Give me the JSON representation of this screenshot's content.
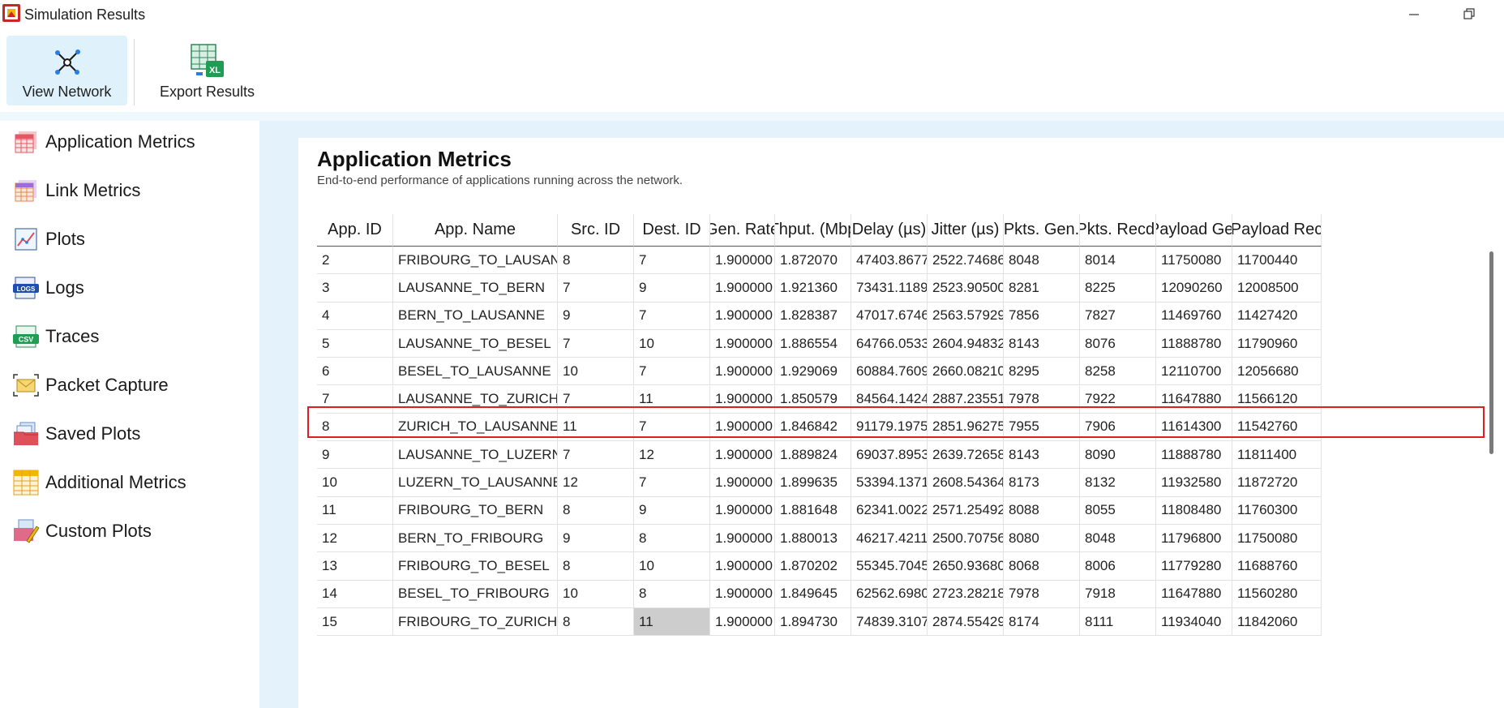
{
  "window": {
    "title": "Simulation Results"
  },
  "ribbon": {
    "view_network": "View Network",
    "export_results": "Export Results",
    "export_badge": "XL"
  },
  "sidebar": {
    "items": [
      {
        "label": "Application Metrics",
        "icon": "table-icon"
      },
      {
        "label": "Link Metrics",
        "icon": "table-icon"
      },
      {
        "label": "Plots",
        "icon": "plot-icon"
      },
      {
        "label": "Logs",
        "icon": "logs-icon"
      },
      {
        "label": "Traces",
        "icon": "csv-icon"
      },
      {
        "label": "Packet Capture",
        "icon": "envelope-icon"
      },
      {
        "label": "Saved Plots",
        "icon": "saved-plots-icon"
      },
      {
        "label": "Additional Metrics",
        "icon": "table-icon"
      },
      {
        "label": "Custom Plots",
        "icon": "custom-plot-icon"
      }
    ],
    "badges": {
      "logs": "LOGS",
      "csv": "CSV"
    }
  },
  "panel": {
    "title": "Application Metrics",
    "subtitle": "End-to-end performance of applications running across the network."
  },
  "table": {
    "headers": [
      "App. ID",
      "App. Name",
      "Src. ID",
      "Dest. ID",
      "Gen. Rate",
      "Thput. (Mbp",
      "Delay (µs)",
      "Jitter (µs)",
      "Pkts. Gen.",
      "Pkts. Recd.",
      "Payload Ger",
      "Payload Rec"
    ],
    "rows": [
      [
        "2",
        "FRIBOURG_TO_LAUSANNE",
        "8",
        "7",
        "1.900000",
        "1.872070",
        "47403.867702",
        "2522.746863",
        "8048",
        "8014",
        "11750080",
        "11700440"
      ],
      [
        "3",
        "LAUSANNE_TO_BERN",
        "7",
        "9",
        "1.900000",
        "1.921360",
        "73431.118981",
        "2523.905009",
        "8281",
        "8225",
        "12090260",
        "12008500"
      ],
      [
        "4",
        "BERN_TO_LAUSANNE",
        "9",
        "7",
        "1.900000",
        "1.828387",
        "47017.674686",
        "2563.579293",
        "7856",
        "7827",
        "11469760",
        "11427420"
      ],
      [
        "5",
        "LAUSANNE_TO_BESEL",
        "7",
        "10",
        "1.900000",
        "1.886554",
        "64766.053382",
        "2604.948328",
        "8143",
        "8076",
        "11888780",
        "11790960"
      ],
      [
        "6",
        "BESEL_TO_LAUSANNE",
        "10",
        "7",
        "1.900000",
        "1.929069",
        "60884.760979",
        "2660.082100",
        "8295",
        "8258",
        "12110700",
        "12056680"
      ],
      [
        "7",
        "LAUSANNE_TO_ZURICH",
        "7",
        "11",
        "1.900000",
        "1.850579",
        "84564.142414",
        "2887.235511",
        "7978",
        "7922",
        "11647880",
        "11566120"
      ],
      [
        "8",
        "ZURICH_TO_LAUSANNE",
        "11",
        "7",
        "1.900000",
        "1.846842",
        "91179.197543",
        "2851.962758",
        "7955",
        "7906",
        "11614300",
        "11542760"
      ],
      [
        "9",
        "LAUSANNE_TO_LUZERN",
        "7",
        "12",
        "1.900000",
        "1.889824",
        "69037.895396",
        "2639.726582",
        "8143",
        "8090",
        "11888780",
        "11811400"
      ],
      [
        "10",
        "LUZERN_TO_LAUSANNE",
        "12",
        "7",
        "1.900000",
        "1.899635",
        "53394.137147",
        "2608.543649",
        "8173",
        "8132",
        "11932580",
        "11872720"
      ],
      [
        "11",
        "FRIBOURG_TO_BERN",
        "8",
        "9",
        "1.900000",
        "1.881648",
        "62341.002288",
        "2571.254927",
        "8088",
        "8055",
        "11808480",
        "11760300"
      ],
      [
        "12",
        "BERN_TO_FRIBOURG",
        "9",
        "8",
        "1.900000",
        "1.880013",
        "46217.421115",
        "2500.707566",
        "8080",
        "8048",
        "11796800",
        "11750080"
      ],
      [
        "13",
        "FRIBOURG_TO_BESEL",
        "8",
        "10",
        "1.900000",
        "1.870202",
        "55345.704541",
        "2650.936804",
        "8068",
        "8006",
        "11779280",
        "11688760"
      ],
      [
        "14",
        "BESEL_TO_FRIBOURG",
        "10",
        "8",
        "1.900000",
        "1.849645",
        "62562.698062",
        "2723.282181",
        "7978",
        "7918",
        "11647880",
        "11560280"
      ],
      [
        "15",
        "FRIBOURG_TO_ZURICH",
        "8",
        "11",
        "1.900000",
        "1.894730",
        "74839.310770",
        "2874.554298",
        "8174",
        "8111",
        "11934040",
        "11842060"
      ]
    ],
    "highlighted_row_app_id": "7",
    "selected_cell": {
      "row_app_id": "15",
      "column": "Dest. ID"
    },
    "colors": {
      "highlight_border": "#e01e1e",
      "selected_cell": "#cdcdcd",
      "ribbon_active": "#dff1fb",
      "main_bg": "#e4f3fb"
    }
  }
}
